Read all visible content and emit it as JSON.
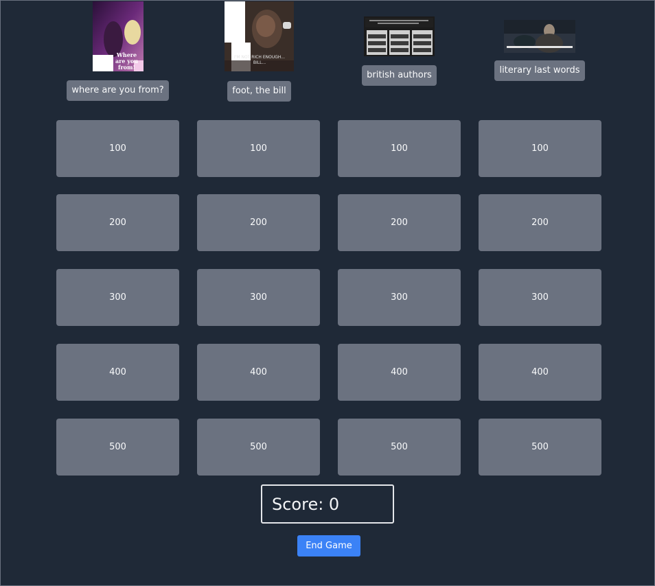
{
  "categories": [
    {
      "label": "where are you from?",
      "thumb_caption": "Where are you from!",
      "thumb_icon": "meme-gif-thumbnail"
    },
    {
      "label": "foot, the bill",
      "thumb_caption": "I'M NOT RICH ENOUGH... BILL...",
      "thumb_icon": "meme-gif-thumbnail"
    },
    {
      "label": "british authors",
      "thumb_icon": "quiz-screenshot-thumbnail"
    },
    {
      "label": "literary last words",
      "thumb_icon": "movie-still-thumbnail"
    }
  ],
  "rows": [
    {
      "value": "100"
    },
    {
      "value": "200"
    },
    {
      "value": "300"
    },
    {
      "value": "400"
    },
    {
      "value": "500"
    }
  ],
  "score": {
    "text": "Score: 0"
  },
  "end_button": {
    "label": "End Game"
  },
  "colors": {
    "background": "#1f2937",
    "tile": "#6b7280",
    "button": "#3b82f6"
  }
}
